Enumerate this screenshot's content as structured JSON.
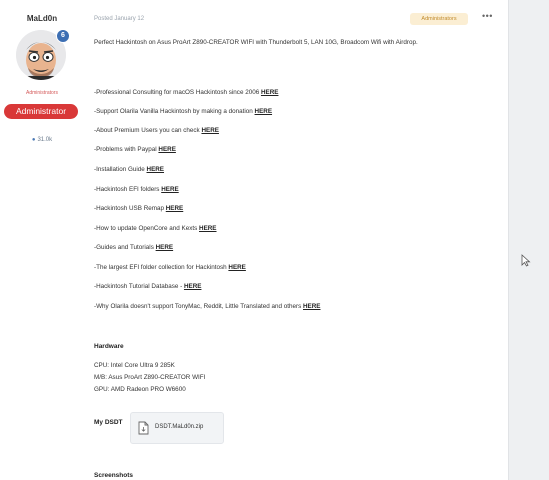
{
  "author": {
    "name": "MaLd0n",
    "group_text": "Administrators",
    "badge": "Administrator",
    "online_badge": "6",
    "post_count": "31.0k"
  },
  "post": {
    "posted": "Posted January 12",
    "role_pill": "Administrators",
    "more": "•••",
    "intro": "Perfect Hackintosh on Asus ProArt Z890-CREATOR WIFI with Thunderbolt 5, LAN 10G, Broadcom Wifi with Airdrop.",
    "links": [
      {
        "text": "-Professional Consulting for macOS Hackintosh since 2006 ",
        "link": "HERE"
      },
      {
        "text": "-Support Olarila Vanilla Hackintosh by making a donation ",
        "link": "HERE"
      },
      {
        "text": "-About Premium Users you can check ",
        "link": "HERE"
      },
      {
        "text": "-Problems with Paypal ",
        "link": "HERE"
      },
      {
        "text": "-Installation Guide ",
        "link": "HERE"
      },
      {
        "text": "-Hackintosh EFI folders ",
        "link": "HERE"
      },
      {
        "text": "-Hackintosh USB Remap ",
        "link": "HERE"
      },
      {
        "text": "-How to update OpenCore and Kexts ",
        "link": "HERE"
      },
      {
        "text": "-Guides and Tutorials ",
        "link": "HERE"
      },
      {
        "text": "-The largest EFI folder collection for Hackintosh ",
        "link": "HERE"
      },
      {
        "text": "-Hackintosh Tutorial Database - ",
        "link": "HERE"
      },
      {
        "text": "-Why Olarila doesn't support TonyMac, Reddit, Little Translated and others ",
        "link": "HERE"
      }
    ],
    "hardware_title": "Hardware",
    "hardware": [
      "CPU: Intel Core Ultra 9 285K",
      "M/B: Asus ProArt Z890-CREATOR WIFI",
      "GPU: AMD Radeon PRO W6600"
    ],
    "dsdt_title": "My DSDT",
    "dsdt_file": "DSDT.MaLd0n.zip",
    "screenshots_title": "Screenshots"
  }
}
